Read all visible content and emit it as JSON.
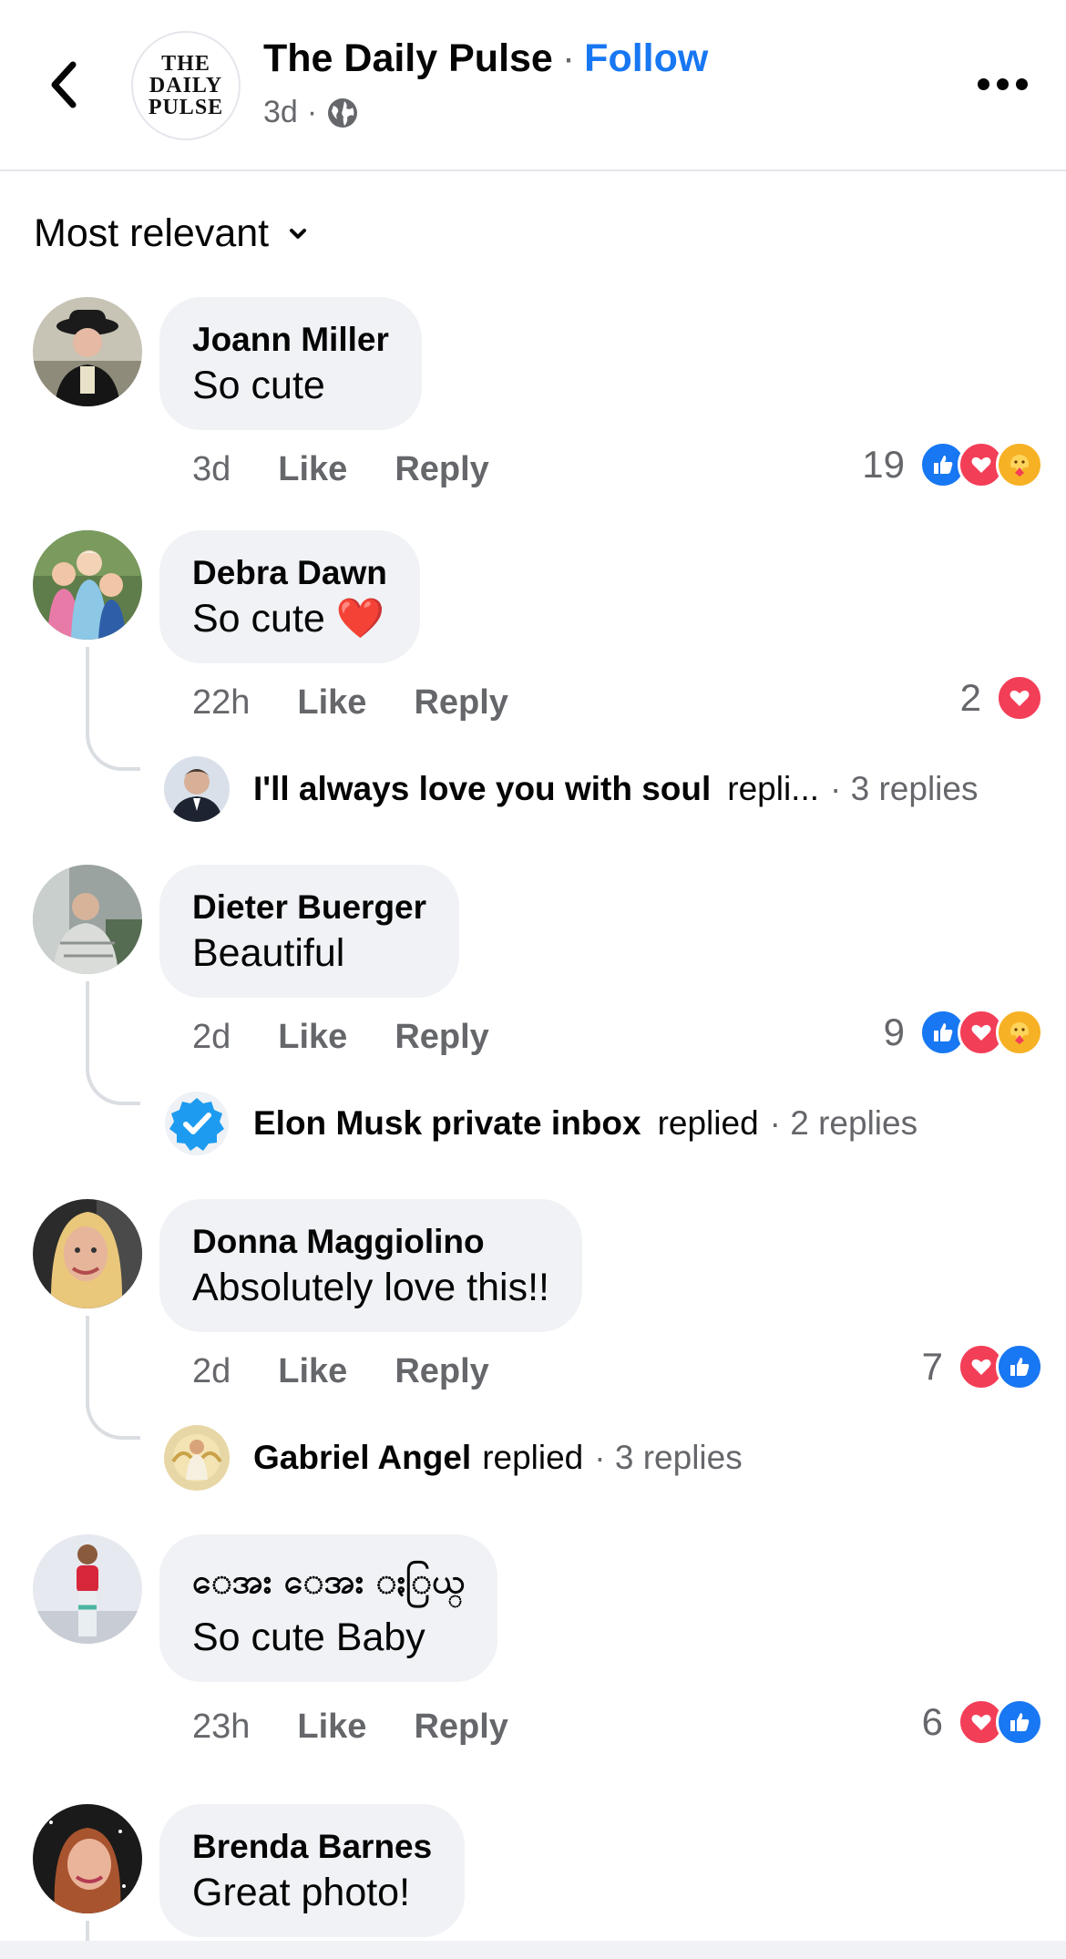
{
  "header": {
    "page_name": "The Daily Pulse",
    "separator": "·",
    "follow_label": "Follow",
    "post_age": "3d",
    "meta_separator": "·",
    "logo_lines": [
      "THE",
      "DAILY",
      "PULSE"
    ]
  },
  "sort": {
    "label": "Most relevant"
  },
  "comments": [
    {
      "author": "Joann Miller",
      "text": "So cute",
      "time": "3d",
      "like": "Like",
      "reply": "Reply",
      "reaction_count": "19",
      "reactions": [
        "like-icon",
        "love-icon",
        "care-icon"
      ]
    },
    {
      "author": "Debra Dawn",
      "text": "So cute ❤️",
      "time": "22h",
      "like": "Like",
      "reply": "Reply",
      "reaction_count": "2",
      "reactions": [
        "love-icon"
      ],
      "replies": {
        "name": "I'll always love you with soul",
        "verb": "repli...",
        "count": "· 3 replies"
      }
    },
    {
      "author": "Dieter Buerger",
      "text": "Beautiful",
      "time": "2d",
      "like": "Like",
      "reply": "Reply",
      "reaction_count": "9",
      "reactions": [
        "like-icon",
        "love-icon",
        "care-icon"
      ],
      "replies": {
        "name": "Elon Musk private inbox",
        "verb": "replied",
        "count": "· 2 replies"
      }
    },
    {
      "author": "Donna Maggiolino",
      "text": "Absolutely love this!!",
      "time": "2d",
      "like": "Like",
      "reply": "Reply",
      "reaction_count": "7",
      "reactions": [
        "love-icon",
        "like-icon"
      ],
      "replies": {
        "name": "Gabriel Angel",
        "verb": "replied",
        "count": "· 3 replies"
      }
    },
    {
      "author": "ေအး ေအး ႏြယ္",
      "text": "So cute Baby",
      "time": "23h",
      "like": "Like",
      "reply": "Reply",
      "reaction_count": "6",
      "reactions": [
        "love-icon",
        "like-icon"
      ]
    },
    {
      "author": "Brenda Barnes",
      "text": "Great photo!"
    }
  ],
  "colors": {
    "accent": "#1877f2",
    "love": "#f33e58",
    "care": "#f7b125",
    "bubble": "#f0f2f5",
    "secondary_text": "#65676b"
  }
}
